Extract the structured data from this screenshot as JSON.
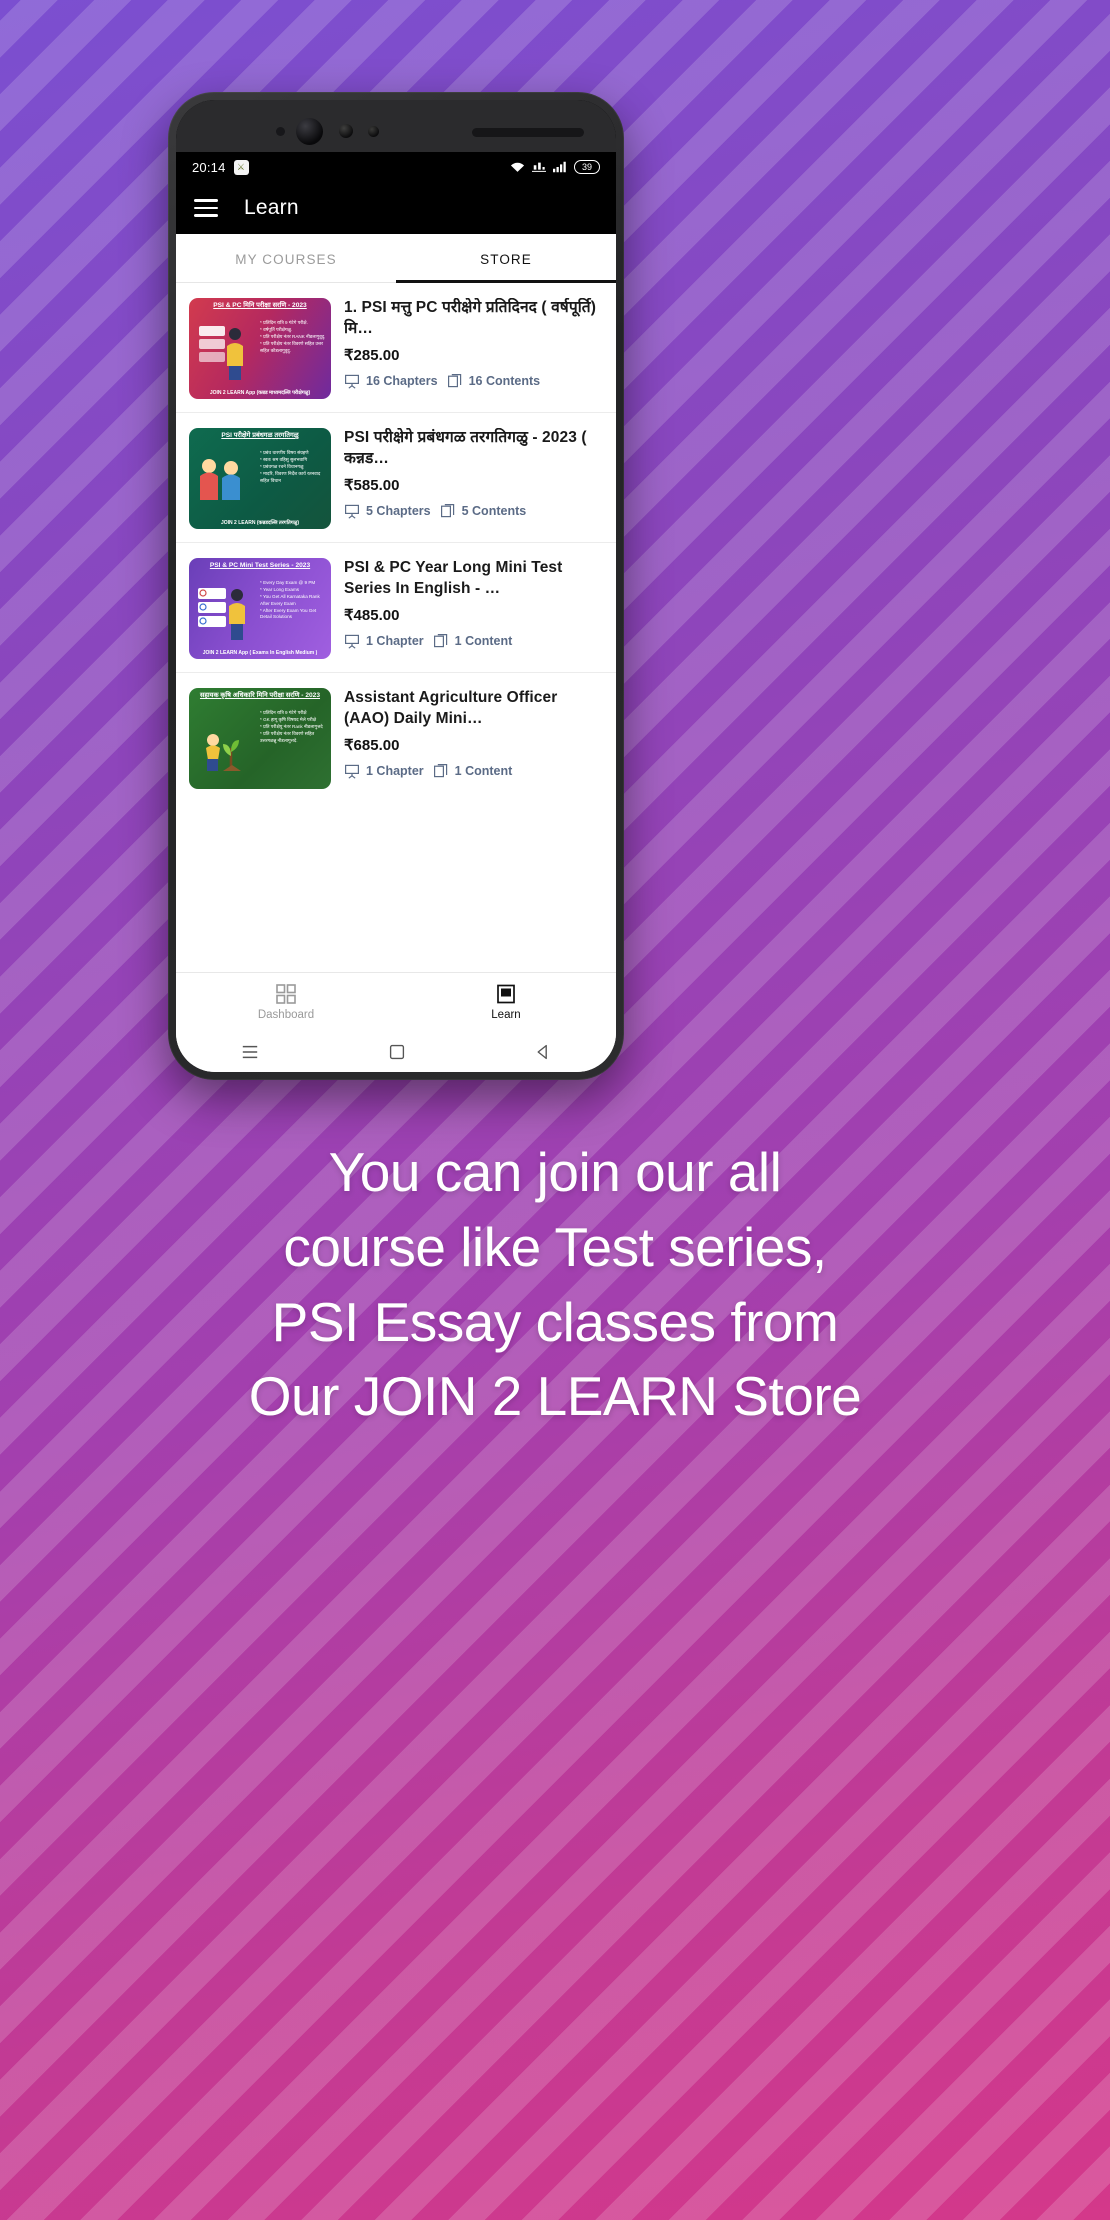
{
  "status_bar": {
    "time": "20:14",
    "emblem_icon": "india-emblem-icon",
    "wifi_icon": "wifi-icon",
    "network_icon": "mobile-data-icon",
    "signal_icon": "signal-bars-icon",
    "battery_level": "39"
  },
  "app_bar": {
    "menu_icon": "hamburger-menu-icon",
    "title": "Learn"
  },
  "tabs": [
    {
      "label": "MY COURSES",
      "active": false
    },
    {
      "label": "STORE",
      "active": true
    }
  ],
  "courses": [
    {
      "title": "1. PSI मत्तु PC परीक्षेगे प्रतिदिनद ( वर्षपूर्ति) मि…",
      "price": "₹285.00",
      "chapters": "16 Chapters",
      "contents": "16 Contents",
      "thumb_title": "PSI & PC मिनि परीक्षा सरणि - 2023",
      "thumb_bullets": "* प्रतिदिन रात्रि 9 गंटेगे परीक्षे.\n* वर्षपूर्ति परीक्षेगळु.\n* प्रति परीक्षेय नंतर RANK नीडलागुवुदु.\n* प्रति परीक्षेय नंतर विवरणे सहित उत्तर सहित कॊडलागुवुदु.",
      "thumb_footer": "JOIN 2 LEARN App  (कन्नड माध्यमदल्लि परीक्षेगळु)",
      "theme": "th1"
    },
    {
      "title": "PSI परीक्षेगे प्रबंधगळ तरगतिगळु - 2023 ( कन्नड…",
      "price": "₹585.00",
      "chapters": "5 Chapters",
      "contents": "5 Contents",
      "thumb_title": "PSI परीक्षेगे प्रबंधगळ तरगतिगळु",
      "thumb_bullets": "* प्रबंध धारणीय विषय संग्रहणे\n* स्वतः श्रम वहिसु सुलभवागि\n* प्रबंधगळ रचने विधानगळु\n* मादरि, विवरण निर्देश कार्य रतनवाद सहित विधान",
      "thumb_footer": "JOIN 2 LEARN (कन्नडदल्लि तरगतिगळु)",
      "theme": "th2"
    },
    {
      "title": "PSI & PC Year Long Mini Test Series In English - …",
      "price": "₹485.00",
      "chapters": "1 Chapter",
      "contents": "1 Content",
      "thumb_title": "PSI & PC Mini Test Series - 2023",
      "thumb_bullets": "* Every Day Exam @ 9 PM\n* Year Long Exams\n* You Get All Karnataka Rank\n   After Every Exam\n* After Every Exam You Get\n   Detail Solutions",
      "thumb_footer": "JOIN 2 LEARN App  ( Exams In English Medium )",
      "theme": "th3"
    },
    {
      "title": "Assistant Agriculture Officer (AAO) Daily Mini…",
      "price": "₹685.00",
      "chapters": "1 Chapter",
      "contents": "1 Content",
      "thumb_title": "सहायक कृषि अधिकारि मिनि परीक्षा सरणि - 2023",
      "thumb_bullets": "* प्रतिदिन रात्रि 9 गंटेगे परीक्षे\n* GK हागू कृषि विषयद मेले परीक्षे\n* प्रति परीक्षेयु नंतर Rank नीडलागुत्तदे\n* प्रति परीक्षेय नंतर विवरणे सहित उत्तरगळन्नु नीडलागुत्तदे.",
      "thumb_footer": "",
      "theme": "th4"
    }
  ],
  "bottom_nav": [
    {
      "label": "Dashboard",
      "icon": "grid-dashboard-icon",
      "active": false
    },
    {
      "label": "Learn",
      "icon": "book-learn-icon",
      "active": true
    }
  ],
  "system_nav": [
    {
      "icon": "recents-icon"
    },
    {
      "icon": "home-square-icon"
    },
    {
      "icon": "back-triangle-icon"
    }
  ],
  "caption": {
    "line1": "You can join our all",
    "line2": "course like Test series,",
    "line3": "PSI Essay classes from",
    "line4": "Our JOIN 2 LEARN Store"
  },
  "colors": {
    "accent": "#8e3fa8",
    "app_bar": "#000000",
    "meta_text": "#5b6b86"
  }
}
